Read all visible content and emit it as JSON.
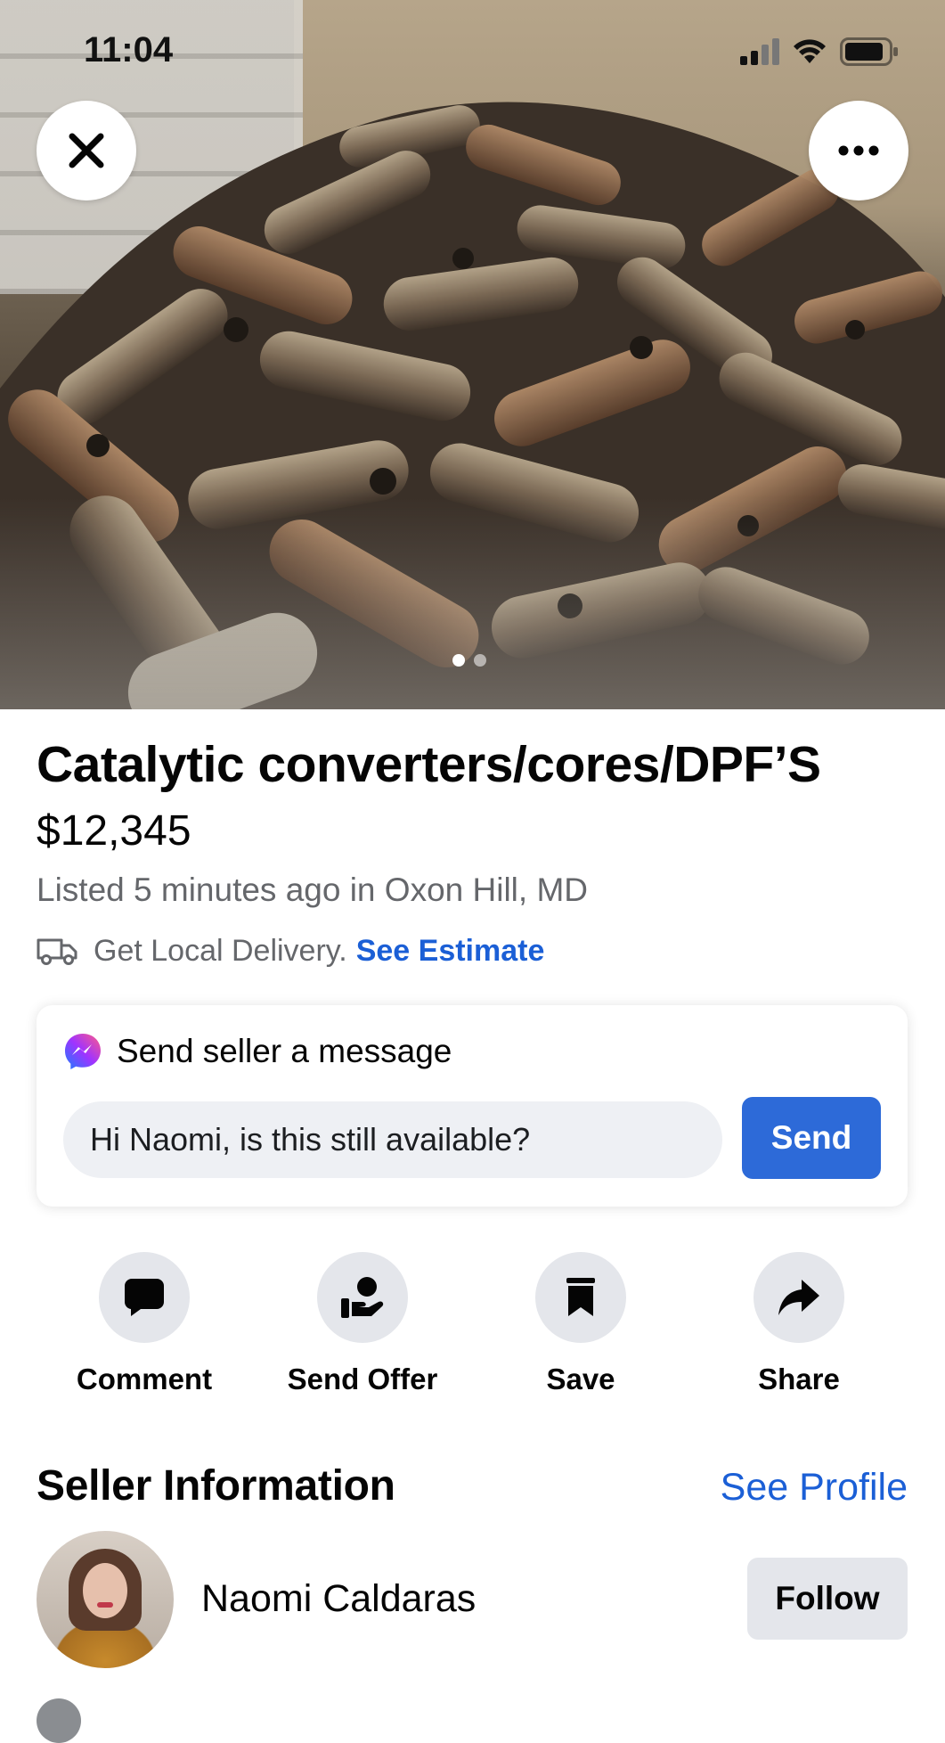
{
  "status_bar": {
    "time": "11:04",
    "icons": [
      "signal-icon",
      "wifi-icon",
      "battery-icon"
    ]
  },
  "hero": {
    "close_icon": "close-icon",
    "more_icon": "more-icon",
    "photo_count": 2,
    "active_photo": 1
  },
  "listing": {
    "title": "Catalytic converters/cores/DPF’S",
    "price": "$12,345",
    "listed": "Listed 5 minutes ago in Oxon Hill, MD",
    "delivery_text": "Get Local Delivery.",
    "delivery_link": "See Estimate"
  },
  "message": {
    "heading": "Send seller a message",
    "input_value": "Hi Naomi, is this still available?",
    "send_label": "Send"
  },
  "actions": [
    {
      "label": "Comment",
      "icon": "comment-icon"
    },
    {
      "label": "Send Offer",
      "icon": "offer-icon"
    },
    {
      "label": "Save",
      "icon": "bookmark-icon"
    },
    {
      "label": "Share",
      "icon": "share-icon"
    }
  ],
  "seller": {
    "heading": "Seller Information",
    "see_profile": "See Profile",
    "name": "Naomi Caldaras",
    "follow_label": "Follow"
  },
  "colors": {
    "accent": "#1b5fd6",
    "send_button": "#2d6ad8",
    "secondary_text": "#65676b",
    "chip_bg": "#e4e6eb"
  }
}
